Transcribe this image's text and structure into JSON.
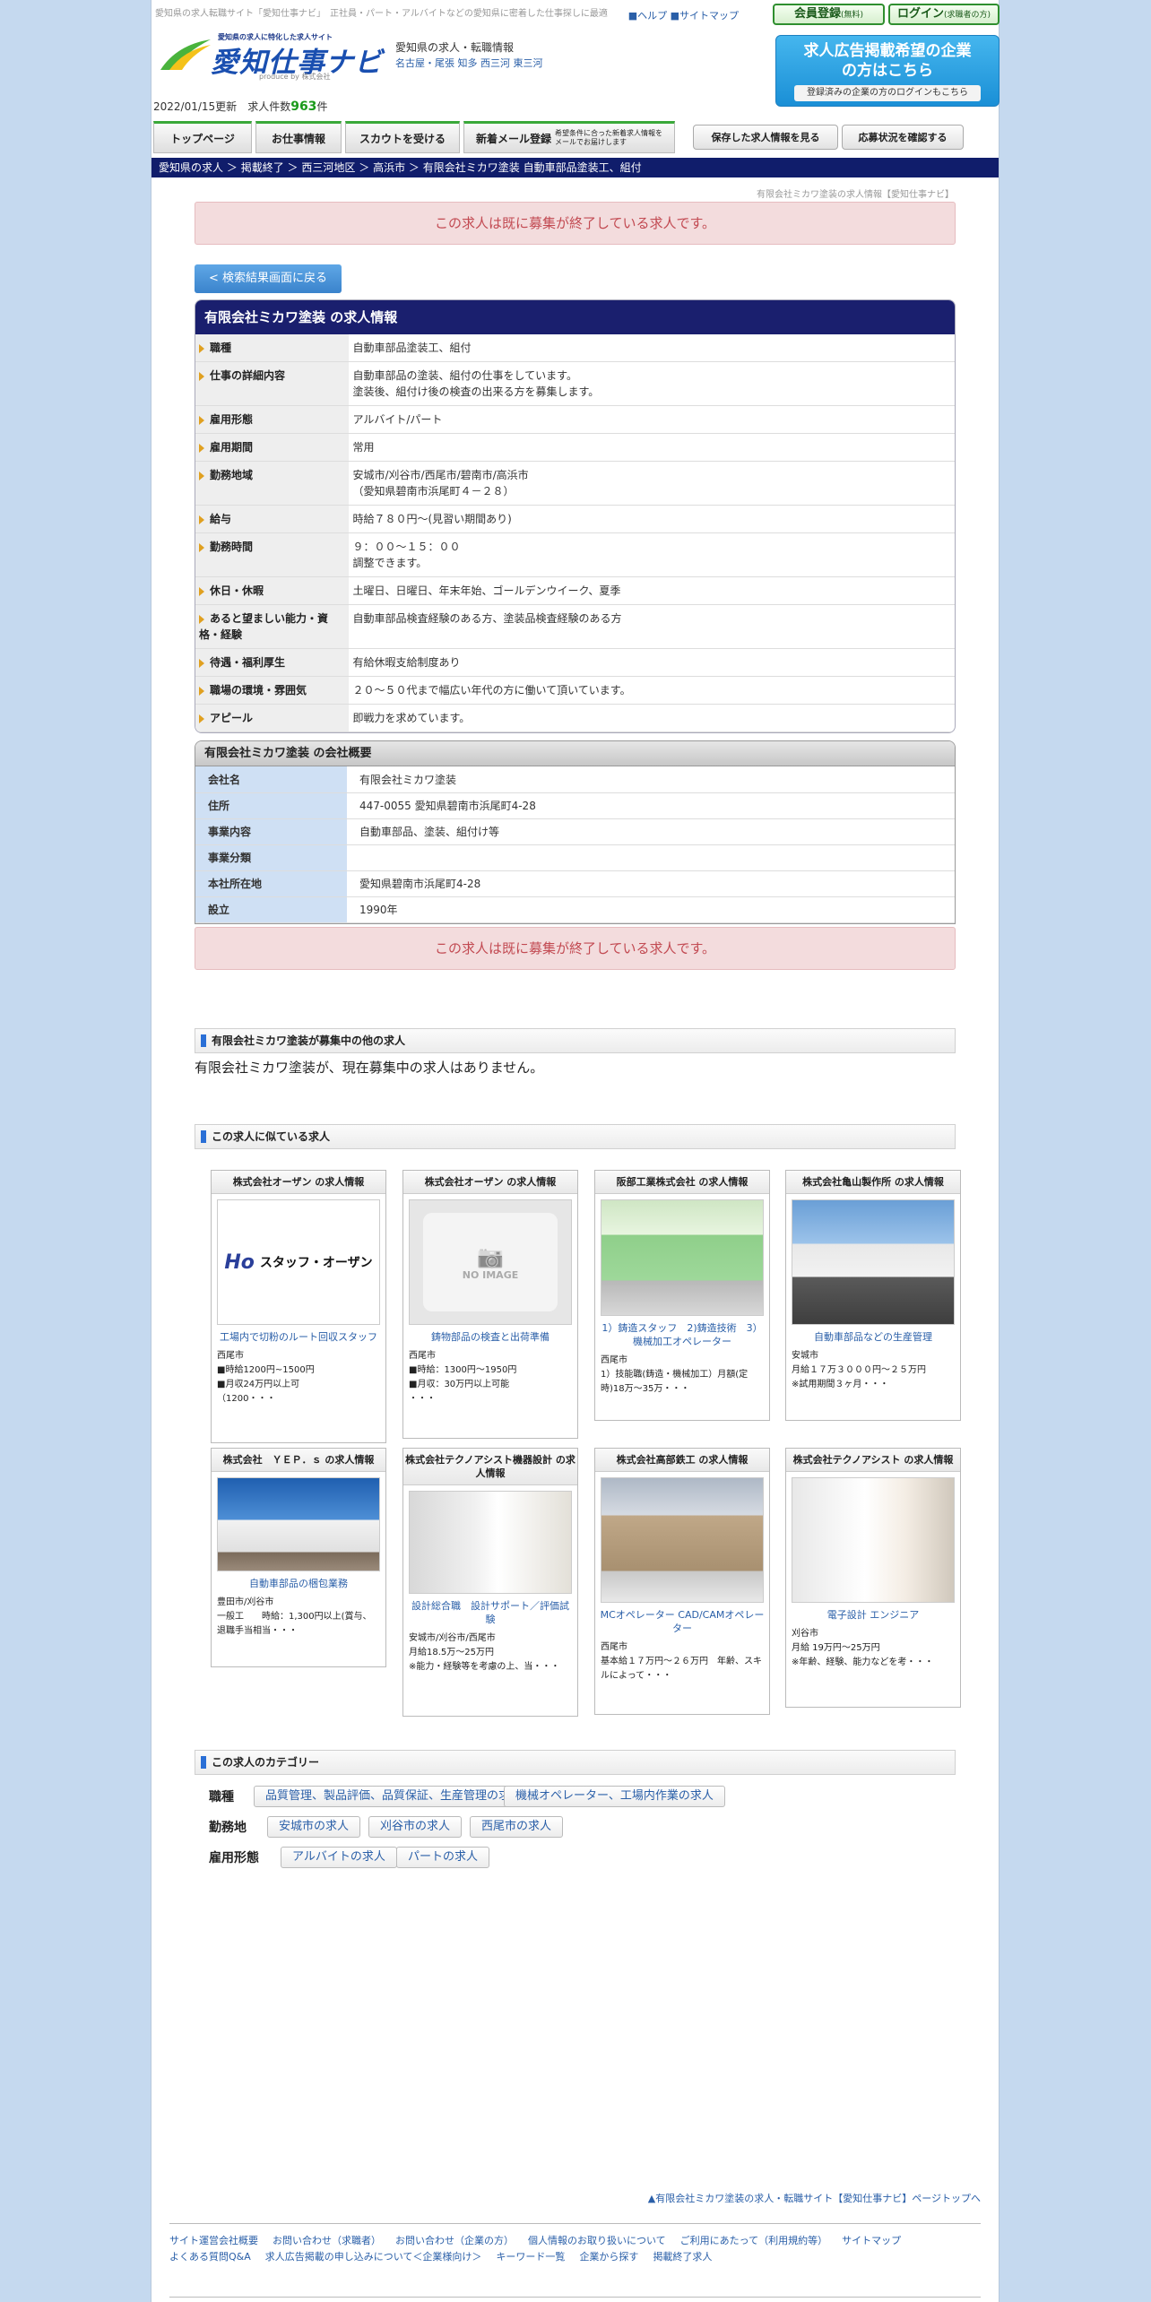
{
  "header": {
    "tagline": "愛知県の求人転職サイト「愛知仕事ナビ」　正社員・パート・アルバイトなどの愛知県に密着した仕事探しに最適",
    "help_link": "■ヘルプ",
    "sitemap_link": "■サイトマップ",
    "member_btn": "会員登録",
    "member_btn_sub": "(無料)",
    "login_btn": "ログイン",
    "login_btn_sub": "(求職者の方)",
    "logo_sub": "愛知県の求人に特化した求人サイト",
    "logo_main": "愛知仕事ナビ",
    "logo_produce": "produce by 株式会社",
    "site_desc": "愛知県の求人・転職情報",
    "site_areas": "名古屋・尾張 知多 西三河 東三河",
    "ad_title": "求人広告掲載希望の企業の方はこちら",
    "ad_btn": "登録済みの企業の方のログインもこちら",
    "updated": "2022/01/15更新",
    "count_label": "求人件数",
    "count_value": "963",
    "count_unit": "件"
  },
  "nav": {
    "top": "トップページ",
    "jobs": "お仕事情報",
    "scout": "スカウトを受ける",
    "mail": "新着メール登録",
    "mail_sub": "希望条件に合った新着求人情報をメールでお届けします",
    "saved": "保存した求人情報を見る",
    "status": "応募状況を確認する"
  },
  "breadcrumb": {
    "c1": "愛知県の求人",
    "c2": "掲載終了",
    "c3": "西三河地区",
    "c4": "高浜市",
    "c5": "有限会社ミカワ塗装 自動車部品塗装工、組付",
    "sep": "＞"
  },
  "page_caption": "有限会社ミカワ塗装の求人情報【愛知仕事ナビ】",
  "closed_notice": "この求人は既に募集が終了している求人です。",
  "back_button": "< 検索結果画面に戻る",
  "job": {
    "heading": "有限会社ミカワ塗装 の求人情報",
    "rows": [
      {
        "k": "職種",
        "v": "自動車部品塗装工、組付"
      },
      {
        "k": "仕事の詳細内容",
        "v": "自動車部品の塗装、組付の仕事をしています。\n塗装後、組付け後の検査の出来る方を募集します。"
      },
      {
        "k": "雇用形態",
        "v": "アルバイト/パート"
      },
      {
        "k": "雇用期間",
        "v": "常用"
      },
      {
        "k": "勤務地域",
        "v": "安城市/刈谷市/西尾市/碧南市/高浜市\n（愛知県碧南市浜尾町４－２８）"
      },
      {
        "k": "給与",
        "v": "時給７８０円〜(見習い期間あり)"
      },
      {
        "k": "勤務時間",
        "v": "９：００〜１５：００\n調整できます。"
      },
      {
        "k": "休日・休暇",
        "v": "土曜日、日曜日、年末年始、ゴールデンウイーク、夏季"
      },
      {
        "k": "あると望ましい能力・資格・経験",
        "v": "自動車部品検査経験のある方、塗装品検査経験のある方"
      },
      {
        "k": "待遇・福利厚生",
        "v": "有給休暇支給制度あり"
      },
      {
        "k": "職場の環境・雰囲気",
        "v": "２０〜５０代まで幅広い年代の方に働いて頂いています。"
      },
      {
        "k": "アピール",
        "v": "即戦力を求めています。"
      }
    ]
  },
  "company": {
    "heading": "有限会社ミカワ塗装 の会社概要",
    "rows": [
      {
        "k": "会社名",
        "v": "有限会社ミカワ塗装"
      },
      {
        "k": "住所",
        "v": "447-0055 愛知県碧南市浜尾町4-28"
      },
      {
        "k": "事業内容",
        "v": "自動車部品、塗装、組付け等"
      },
      {
        "k": "事業分類",
        "v": ""
      },
      {
        "k": "本社所在地",
        "v": "愛知県碧南市浜尾町4-28"
      },
      {
        "k": "設立",
        "v": "1990年"
      }
    ]
  },
  "other_jobs": {
    "heading": "有限会社ミカワ塗装が募集中の他の求人",
    "none_text": "有限会社ミカワ塗装が、現在募集中の求人はありません。"
  },
  "similar": {
    "heading": "この求人に似ている求人",
    "cards": [
      {
        "company": "株式会社オーザン の求人情報",
        "image": "staff-ozan-logo",
        "logo_text": "スタッフ・オーザン",
        "title": "工場内で切粉のルート回収スタッフ",
        "desc": "西尾市\n■時給1200円~1500円\n■月収24万円以上可\n（1200・・・"
      },
      {
        "company": "株式会社オーザン の求人情報",
        "image": "no-image",
        "noimg_text": "NO IMAGE",
        "title": "鋳物部品の検査と出荷準備",
        "desc": "西尾市\n■時給：1300円～1950円\n■月収：30万円以上可能\n・・・"
      },
      {
        "company": "阪部工業株式会社 の求人情報",
        "image": "factory-photo-green",
        "title": "1）鋳造スタッフ　2)鋳造技術　3）機械加工オペレーター",
        "desc": "西尾市\n1）技能職(鋳造・機械加工）月額(定時)18万～35万・・・"
      },
      {
        "company": "株式会社亀山製作所 の求人情報",
        "image": "factory-photo-sky",
        "title": "自動車部品などの生産管理",
        "desc": "安城市\n月給１７万３０００円～２５万円\n※試用期間３ヶ月・・・"
      },
      {
        "company": "株式会社　ＹＥＰ．ｓ の求人情報",
        "image": "yep-building-photo",
        "title": "自動車部品の梱包業務",
        "desc": "豊田市/刈谷市\n一般工　　時給：1,300円以上(賞与、退職手当相当・・・"
      },
      {
        "company": "株式会社テクノアシスト機器設計 の求人情報",
        "image": "engineer-desk-photo",
        "title": "設計総合職　設計サポート／評価試験",
        "desc": "安城市/刈谷市/西尾市\n月給18.5万～25万円\n※能力・経験等を考慮の上、当・・・"
      },
      {
        "company": "株式会社高部鉄工 の求人情報",
        "image": "factory-building-photo",
        "title": "MCオペレーター CAD/CAMオペレーター",
        "desc": "西尾市\n基本給１７万円〜２６万円　年齢、スキルによって・・・"
      },
      {
        "company": "株式会社テクノアシスト の求人情報",
        "image": "engineer-photo",
        "title": "電子設計 エンジニア",
        "desc": "刈谷市\n月給 19万円〜25万円\n※年齢、経験、能力などを考・・・"
      }
    ]
  },
  "categories": {
    "heading": "この求人のカテゴリー",
    "rows": [
      {
        "label": "職種",
        "tags": [
          "品質管理、製品評価、品質保証、生産管理の求人",
          "機械オペレーター、工場内作業の求人"
        ]
      },
      {
        "label": "勤務地",
        "tags": [
          "安城市の求人",
          "刈谷市の求人",
          "西尾市の求人"
        ]
      },
      {
        "label": "雇用形態",
        "tags": [
          "アルバイトの求人",
          "パートの求人"
        ]
      }
    ]
  },
  "footer": {
    "pagetop": "▲有限会社ミカワ塗装の求人・転職サイト【愛知仕事ナビ】ページトップへ",
    "links": [
      "サイト運営会社概要",
      "お問い合わせ（求職者）",
      "お問い合わせ（企業の方）",
      "個人情報のお取り扱いについて",
      "ご利用にあたって（利用規約等）",
      "サイトマップ",
      "よくある質問Q&A",
      "求人広告掲載の申し込みについて＜企業様向け＞",
      "キーワード一覧",
      "企業から探す",
      "掲載終了求人"
    ]
  },
  "colors": {
    "page_bg": "#c5d9ef",
    "navy": "#1a1f6e",
    "notice_bg": "#f3dcdd",
    "notice_text": "#c24a52",
    "link": "#2a5fa8",
    "accent_green": "#2f8f2f",
    "accent_blue": "#1a8fd6"
  }
}
